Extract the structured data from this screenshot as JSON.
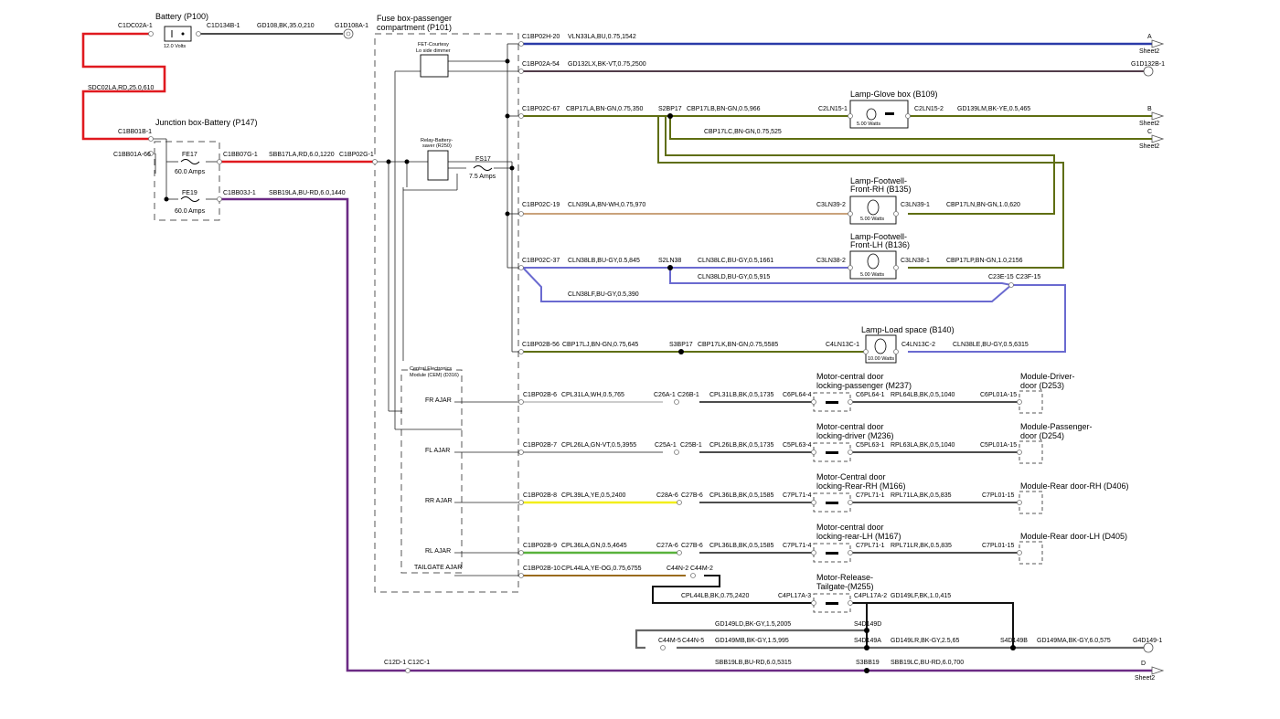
{
  "colors": {
    "red": "#e0191f",
    "purple": "#6b2a84",
    "blue": "#2a3aa8",
    "darkred": "#3a2030",
    "olive": "#5f6e12",
    "tan": "#c9a27b",
    "lavender": "#6a6ad0",
    "yellow": "#f2ee1a",
    "green": "#59b23c",
    "orange": "#9a6b1e",
    "black": "#111111",
    "grey": "#777777"
  },
  "components": {
    "battery": "Battery (P100)",
    "battery_volts": "12.0 Volts",
    "junction_box": "Junction box-Battery (P147)",
    "fe17": "FE17",
    "fe17_amps": "60.0 Amps",
    "fe19": "FE19",
    "fe19_amps": "60.0 Amps",
    "fuse_box_1": "Fuse box-passenger",
    "fuse_box_2": "compartment (P101)",
    "fet_1": "FET-Courtesy",
    "fet_2": "Lo side dimmer",
    "relay_1": "Relay-Battery-",
    "relay_2": "saver (R250)",
    "fs17": "FS17",
    "fs17_amps": "7.5 Amps",
    "cem_1": "Central Electronics",
    "cem_2": "Module (CEM) (D316)",
    "lamp_glove": "Lamp-Glove box (B109)",
    "lamp_glove_watts": "5.00 Watts",
    "lamp_frh_1": "Lamp-Footwell-",
    "lamp_frh_2": "Front-RH (B135)",
    "lamp_frh_watts": "5.00 Watts",
    "lamp_flh_1": "Lamp-Footwell-",
    "lamp_flh_2": "Front-LH (B136)",
    "lamp_flh_watts": "5.00 Watts",
    "lamp_load": "Lamp-Load space (B140)",
    "lamp_load_watts": "10.00 Watts",
    "motor_m237_1": "Motor-central door",
    "motor_m237_2": "locking-passenger (M237)",
    "motor_m236_1": "Motor-central door",
    "motor_m236_2": "locking-driver (M236)",
    "motor_m166_1": "Motor-Central door",
    "motor_m166_2": "locking-Rear-RH (M166)",
    "motor_m167_1": "Motor-central door",
    "motor_m167_2": "locking-rear-LH (M167)",
    "motor_m255_1": "Motor-Release-",
    "motor_m255_2": "Tailgate-(M255)",
    "mod_d253_1": "Module-Driver-",
    "mod_d253_2": "door (D253)",
    "mod_d254_1": "Module-Passenger-",
    "mod_d254_2": "door (D254)",
    "mod_d406": "Module-Rear door-RH (D406)",
    "mod_d405": "Module-Rear door-LH (D405)"
  },
  "ajar": {
    "fr": "FR AJAR",
    "fl": "FL AJAR",
    "rr": "RR AJAR",
    "rl": "RL AJAR",
    "tailgate": "TAILGATE AJAR"
  },
  "connectors": {
    "c1dc02a_1": "C1DC02A-1",
    "c1d134b_1": "C1D134B-1",
    "g1d108a_1": "G1D108A-1",
    "c1bb01b_1": "C1BB01B-1",
    "c1bb01a_66": "C1BB01A-66",
    "c1bb07g_1": "C1BB07G-1",
    "c1bp02g_1": "C1BP02G-1",
    "c1bb03j_1": "C1BB03J-1",
    "c1bp02h_20": "C1BP02H-20",
    "c1bp02a_54": "C1BP02A-54",
    "g1d132b_1": "G1D132B-1",
    "c1bp02c_67": "C1BP02C-67",
    "s2bp17": "S2BP17",
    "c2ln15_1": "C2LN15-1",
    "c2ln15_2": "C2LN15-2",
    "c1bp02c_19": "C1BP02C-19",
    "c3ln39_2": "C3LN39-2",
    "c3ln39_1": "C3LN39-1",
    "c1bp02c_37": "C1BP02C-37",
    "s2ln38": "S2LN38",
    "c3ln38_2": "C3LN38-2",
    "c3ln38_1": "C3LN38-1",
    "c23e_15": "C23E-15",
    "c23f_15": "C23F-15",
    "c1bp02b_56": "C1BP02B-56",
    "s3bp17": "S3BP17",
    "c4ln13c_1": "C4LN13C-1",
    "c4ln13c_2": "C4LN13C-2",
    "c1bp02b_6": "C1BP02B-6",
    "c26a_1": "C26A-1",
    "c26b_1": "C26B-1",
    "c6pl64_4": "C6PL64-4",
    "c6pl64_1": "C6PL64-1",
    "c6pl01a_15": "C6PL01A-15",
    "c1bp02b_7": "C1BP02B-7",
    "c25a_1": "C25A-1",
    "c25b_1": "C25B-1",
    "c5pl63_4": "C5PL63-4",
    "c5pl63_1": "C5PL63-1",
    "c5pl01a_15": "C5PL01A-15",
    "c1bp02b_8": "C1BP02B-8",
    "c28a_6": "C28A-6",
    "c27b_6_rr": "C27B-6",
    "c7pl71_4_rr": "C7PL71-4",
    "c7pl71_1_rr": "C7PL71-1",
    "c7pl01_15_rr": "C7PL01-15",
    "c1bp02b_9": "C1BP02B-9",
    "c27a_6": "C27A-6",
    "c27b_6_rl": "C27B-6",
    "c7pl71_4_rl": "C7PL71-4",
    "c7pl71_1_rl": "C7PL71-1",
    "c7pl01_15_rl": "C7PL01-15",
    "c1bp02b_10": "C1BP02B-10",
    "c44n_2": "C44N-2",
    "c44m_2": "C44M-2",
    "c4pl17a_3": "C4PL17A-3",
    "c4pl17a_2": "C4PL17A-2",
    "s4d149d": "S4D149D",
    "c44m_5": "C44M-5",
    "c44n_5": "C44N-5",
    "s4d149a": "S4D149A",
    "s4d149b": "S4D149B",
    "g4d149_1": "G4D149-1",
    "c12d_1": "C12D-1",
    "c12c_1": "C12C-1",
    "s3bb19": "S3BB19"
  },
  "wires": {
    "sdc02la": "SDC02LA,RD,25.0,610",
    "gd108": "GD108,BK,35.0,210",
    "sbb17la": "SBB17LA,RD,6.0,1220",
    "sbb19la": "SBB19LA,BU-RD,6.0,1440",
    "vln33la": "VLN33LA,BU,0.75,1542",
    "gd132lx": "GD132LX,BK-VT,0.75,2500",
    "cbp17la": "CBP17LA,BN-GN,0.75,350",
    "cbp17lb": "CBP17LB,BN-GN,0.5,966",
    "gd139lm": "GD139LM,BK-YE,0.5,465",
    "cbp17lc": "CBP17LC,BN-GN,0.75,525",
    "cln39la": "CLN39LA,BN-WH,0.75,970",
    "cbp17ln": "CBP17LN,BN-GN,1.0,620",
    "cln38lb": "CLN38LB,BU-GY,0.5,845",
    "cln38lc": "CLN38LC,BU-GY,0.5,1661",
    "cbp17lp": "CBP17LP,BN-GN,1.0,2156",
    "cln38ld": "CLN38LD,BU-GY,0.5,915",
    "cln38lf": "CLN38LF,BU-GY,0.5,390",
    "cbp17lj": "CBP17LJ,BN-GN,0.75,645",
    "cbp17lk": "CBP17LK,BN-GN,0.75,5585",
    "cln38le": "CLN38LE,BU-GY,0.5,6315",
    "cpl31la": "CPL31LA,WH,0.5,765",
    "cpl31lb": "CPL31LB,BK,0.5,1735",
    "rpl64lb": "RPL64LB,BK,0.5,1040",
    "cpl26la": "CPL26LA,GN-VT,0.5,3955",
    "cpl26lb": "CPL26LB,BK,0.5,1735",
    "rpl63la": "RPL63LA,BK,0.5,1040",
    "cpl39la": "CPL39LA,YE,0.5,2400",
    "cpl36lb_rr": "CPL36LB,BK,0.5,1585",
    "rpl71la": "RPL71LA,BK,0.5,835",
    "cpl36la": "CPL36LA,GN,0.5,4645",
    "cpl36lb_rl": "CPL36LB,BK,0.5,1585",
    "rpl71lr": "RPL71LR,BK,0.5,835",
    "cpl44la": "CPL44LA,YE-OG,0.75,6755",
    "cpl44lb": "CPL44LB,BK,0.75,2420",
    "gd149lf": "GD149LF,BK,1.0,415",
    "gd149ld": "GD149LD,BK-GY,1.5,2005",
    "gd149mb": "GD149MB,BK-GY,1.5,995",
    "gd149lr": "GD149LR,BK-GY,2.5,65",
    "gd149ma": "GD149MA,BK-GY,6.0,575",
    "sbb19lb": "SBB19LB,BU-RD,6.0,5315",
    "sbb19lc": "SBB19LC,BU-RD,6.0,700"
  },
  "offpage": {
    "a": "A",
    "b": "B",
    "c": "C",
    "d": "D",
    "sheet2": "Sheet2",
    "g1d132b": "G1D132B-1",
    "g4d149": "G4D149-1"
  }
}
